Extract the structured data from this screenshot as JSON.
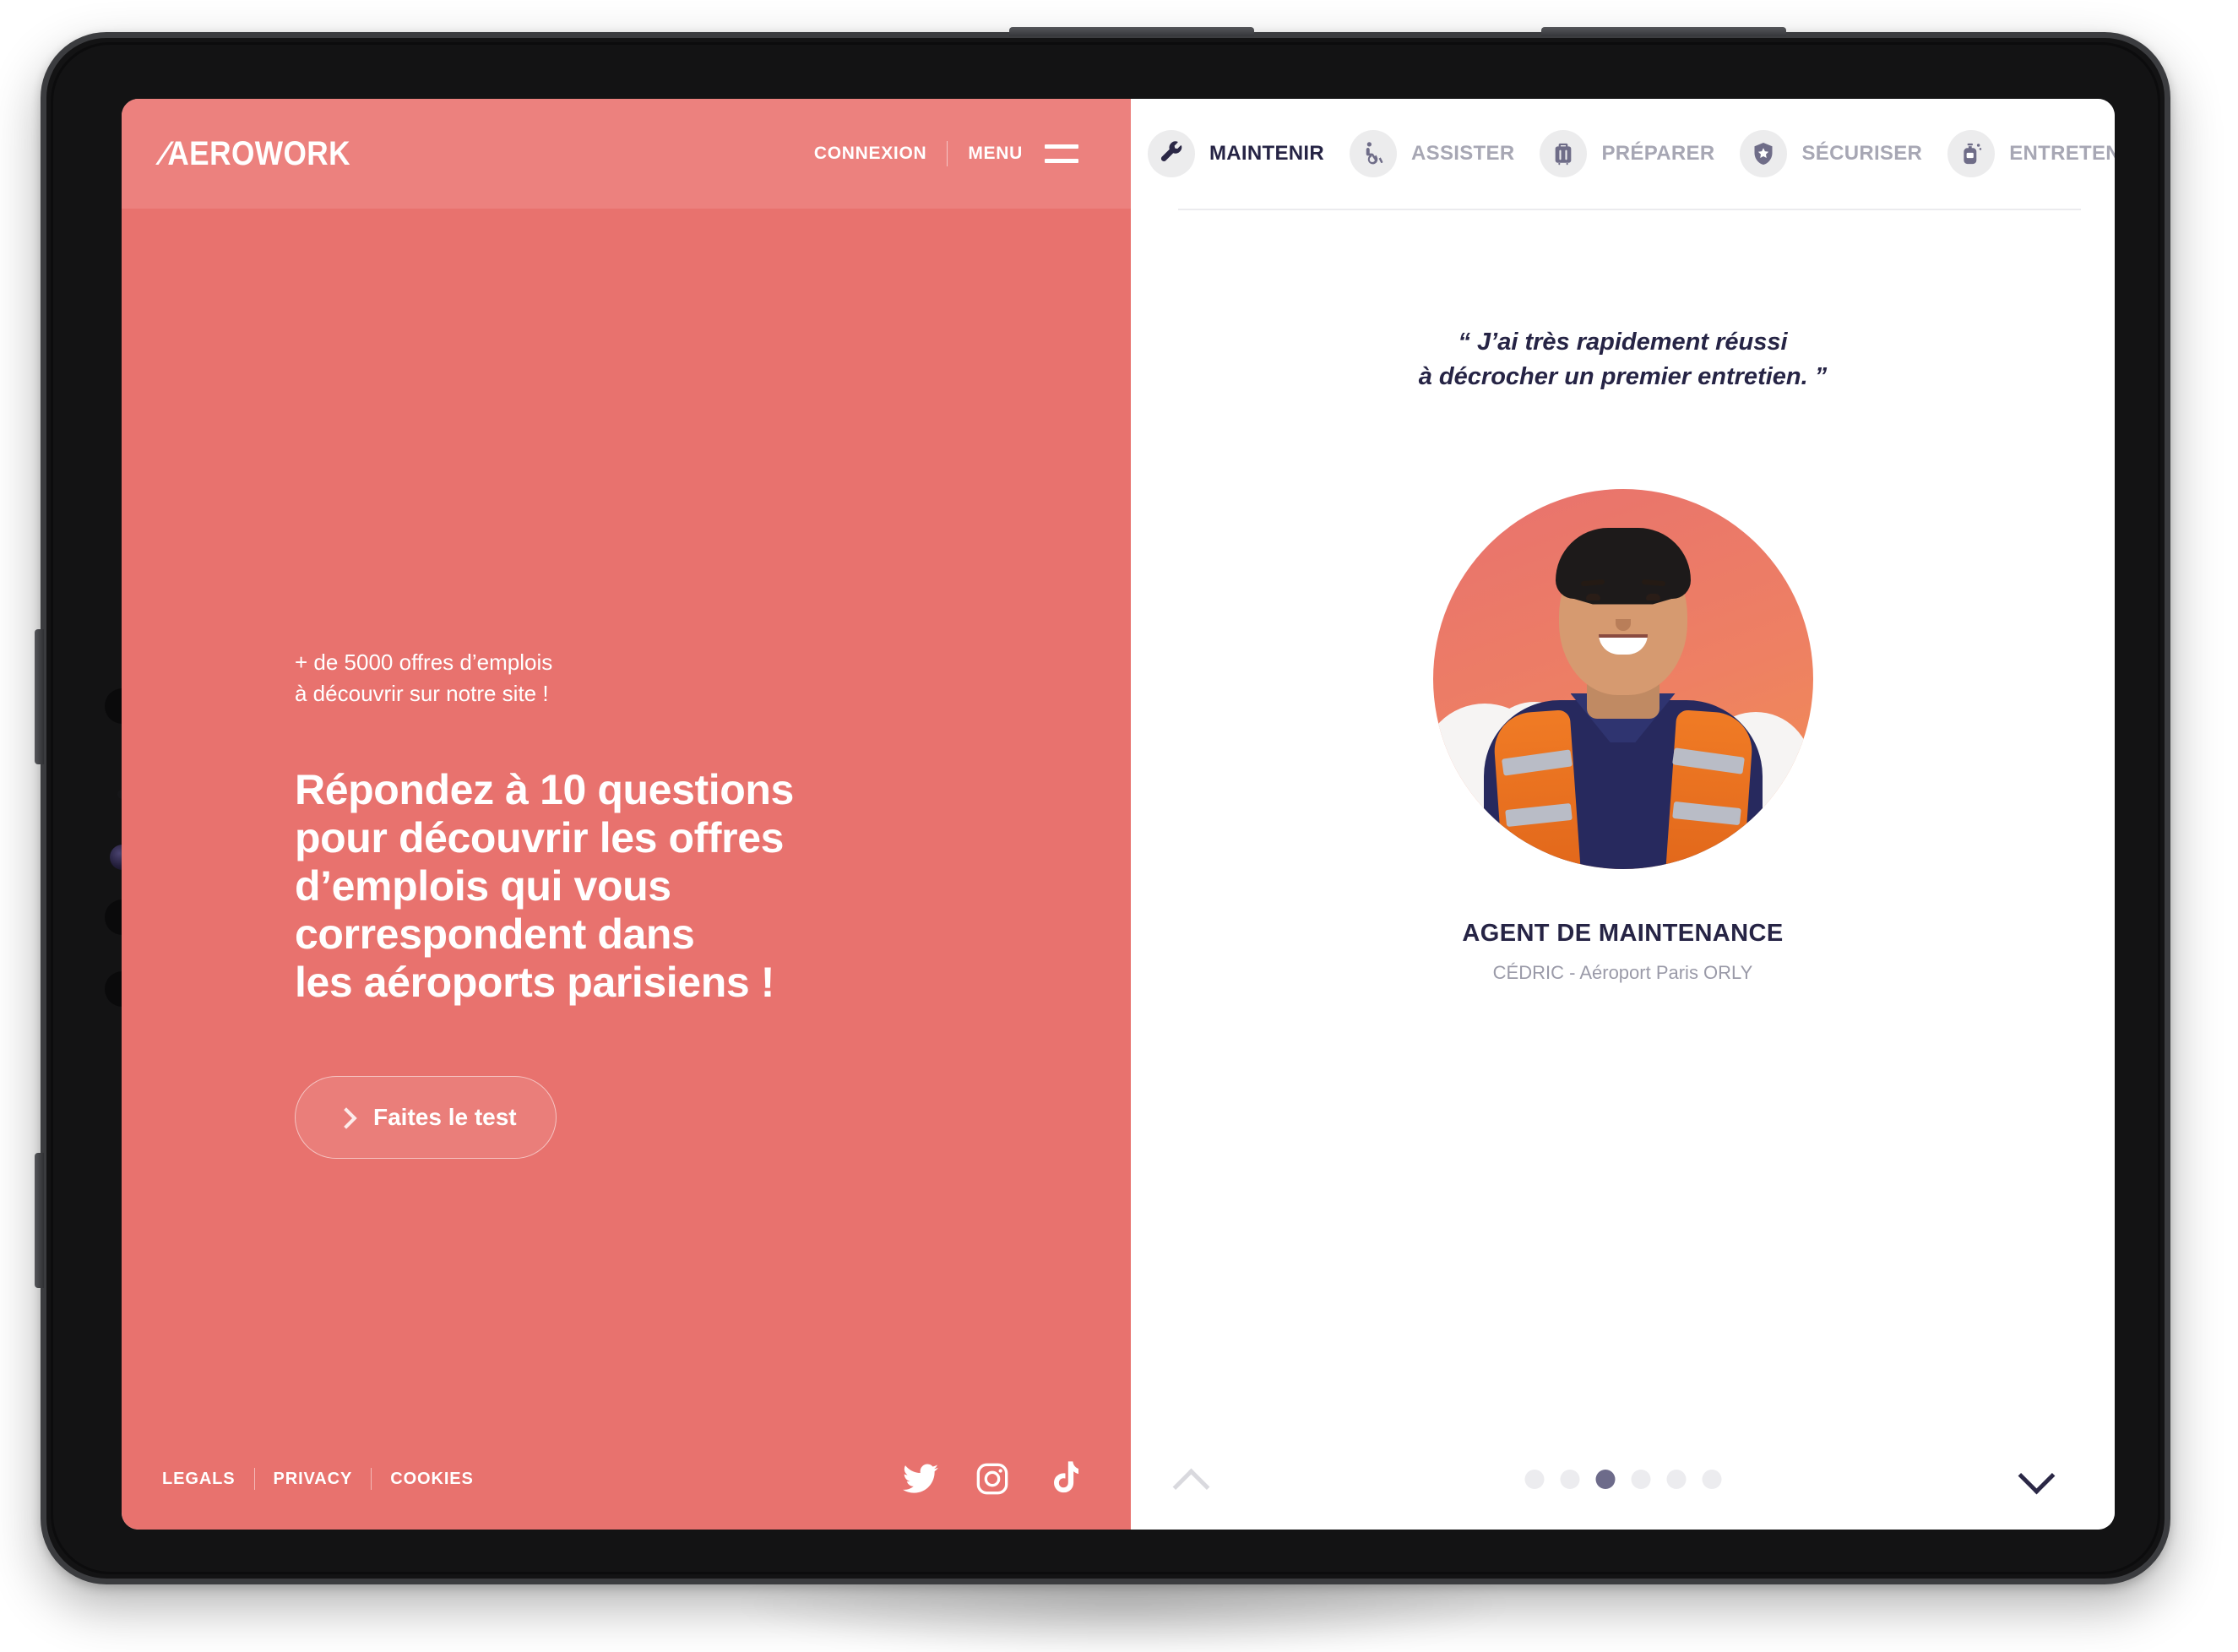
{
  "brand": {
    "logo_text": "AEROWORK",
    "coral": "#E8726E",
    "coral_header": "#EC817E",
    "navy": "#262445",
    "muted": "#a7a7b4"
  },
  "header": {
    "login_label": "CONNEXION",
    "menu_label": "MENU",
    "burger_icon": "hamburger-menu-icon"
  },
  "hero": {
    "kicker": "+ de 5000 offres d’emplois\nà découvrir sur notre site !",
    "headline": "Répondez à 10 questions\npour découvrir les offres\nd’emplois qui vous\ncorrespondent dans\nles aéroports parisiens !",
    "cta_label": "Faites le test",
    "cta_icon": "chevron-right-icon"
  },
  "footer": {
    "links": [
      "LEGALS",
      "PRIVACY",
      "COOKIES"
    ],
    "socials": [
      {
        "name": "twitter-icon",
        "label": "Twitter"
      },
      {
        "name": "instagram-icon",
        "label": "Instagram"
      },
      {
        "name": "tiktok-icon",
        "label": "TikTok"
      }
    ]
  },
  "tabs": [
    {
      "label": "MAINTENIR",
      "icon": "wrench-icon",
      "active": true
    },
    {
      "label": "ASSISTER",
      "icon": "wheelchair-icon",
      "active": false
    },
    {
      "label": "PRÉPARER",
      "icon": "suitcase-icon",
      "active": false
    },
    {
      "label": "SÉCURISER",
      "icon": "shield-star-icon",
      "active": false
    },
    {
      "label": "ENTRETENIR",
      "icon": "sanitizer-icon",
      "active": false
    },
    {
      "label": "",
      "icon": "clean-hands-icon",
      "active": false
    }
  ],
  "testimonial": {
    "quote": "“ J’ai très rapidement réussi\nà décrocher un premier entretien. ”",
    "portrait_alt": "portrait-agent-de-maintenance",
    "job_title": "AGENT DE MAINTENANCE",
    "person": "CÉDRIC - Aéroport Paris ORLY"
  },
  "carousel": {
    "total": 6,
    "active_index": 3,
    "prev_icon": "chevron-up-icon",
    "next_icon": "chevron-down-icon"
  }
}
